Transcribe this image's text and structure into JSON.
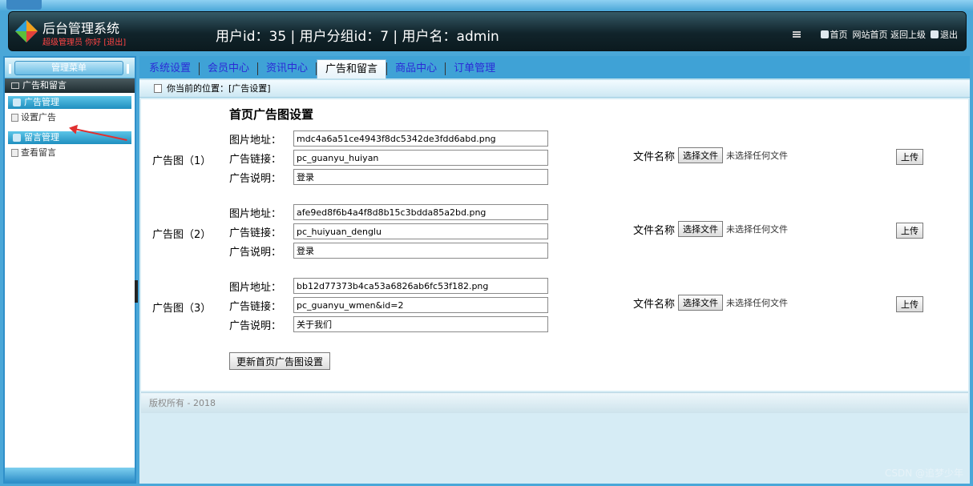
{
  "header": {
    "app_title": "后台管理系统",
    "app_subtitle": "超级管理员 你好 [退出]",
    "user_info": "用户id：35 | 用户分组id：7 | 用户名：admin",
    "links": [
      {
        "label": "首页"
      },
      {
        "label": "网站首页 返回上级"
      },
      {
        "label": "退出"
      }
    ]
  },
  "sidebar": {
    "head_label": "管理菜单",
    "top_row": "广告和留言",
    "categories": [
      {
        "label": "广告管理",
        "items": [
          {
            "label": "设置广告"
          }
        ]
      },
      {
        "label": "留言管理",
        "items": [
          {
            "label": "查看留言"
          }
        ]
      }
    ]
  },
  "tabs": [
    {
      "label": "系统设置"
    },
    {
      "label": "会员中心"
    },
    {
      "label": "资讯中心"
    },
    {
      "label": "广告和留言"
    },
    {
      "label": "商品中心"
    },
    {
      "label": "订单管理"
    }
  ],
  "breadcrumb": {
    "location_label": "你当前的位置：",
    "current": "[广告设置]"
  },
  "form": {
    "title": "首页广告图设置",
    "field_labels": {
      "image": "图片地址：",
      "link": "广告链接：",
      "desc": "广告说明："
    },
    "file_label": "文件名称",
    "choose_file": "选择文件",
    "no_file": "未选择任何文件",
    "upload": "上传",
    "ads": [
      {
        "label": "广告图（1）",
        "image": "mdc4a6a51ce4943f8dc5342de3fdd6abd.png",
        "link": "pc_guanyu_huiyan",
        "desc": "登录"
      },
      {
        "label": "广告图（2）",
        "image": "afe9ed8f6b4a4f8d8b15c3bdda85a2bd.png",
        "link": "pc_huiyuan_denglu",
        "desc": "登录"
      },
      {
        "label": "广告图（3）",
        "image": "bb12d77373b4ca53a6826ab6fc53f182.png",
        "link": "pc_guanyu_wmen&id=2",
        "desc": "关于我们"
      }
    ],
    "save_label": "更新首页广告图设置"
  },
  "footer": {
    "text": "版权所有 - 2018"
  },
  "watermark": "CSDN @追梦少年"
}
